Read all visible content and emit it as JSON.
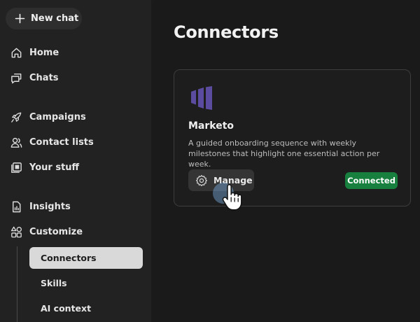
{
  "sidebar": {
    "new_chat_label": "New chat",
    "items": [
      {
        "label": "Home",
        "icon": "home-icon"
      },
      {
        "label": "Chats",
        "icon": "chats-icon"
      },
      {
        "label": "Campaigns",
        "icon": "rocket-icon"
      },
      {
        "label": "Contact lists",
        "icon": "contacts-icon"
      },
      {
        "label": "Your stuff",
        "icon": "folder-icon"
      },
      {
        "label": "Insights",
        "icon": "insights-icon"
      },
      {
        "label": "Customize",
        "icon": "grid-icon"
      }
    ],
    "sub_items": [
      {
        "label": "Connectors",
        "active": true
      },
      {
        "label": "Skills",
        "active": false
      },
      {
        "label": "AI context",
        "active": false
      }
    ]
  },
  "main": {
    "title": "Connectors",
    "card": {
      "name": "Marketo",
      "description": "A guided onboarding sequence with weekly milestones that highlight one essential action per week.",
      "manage_label": "Manage",
      "status": "Connected",
      "logo_icon": "marketo-logo-icon"
    }
  },
  "colors": {
    "sidebar_bg": "#222222",
    "main_bg": "#1a1a1a",
    "active_item_bg": "#d9d9d9",
    "status_green": "#17803e",
    "marketo_purple": "#5c4c9f"
  }
}
